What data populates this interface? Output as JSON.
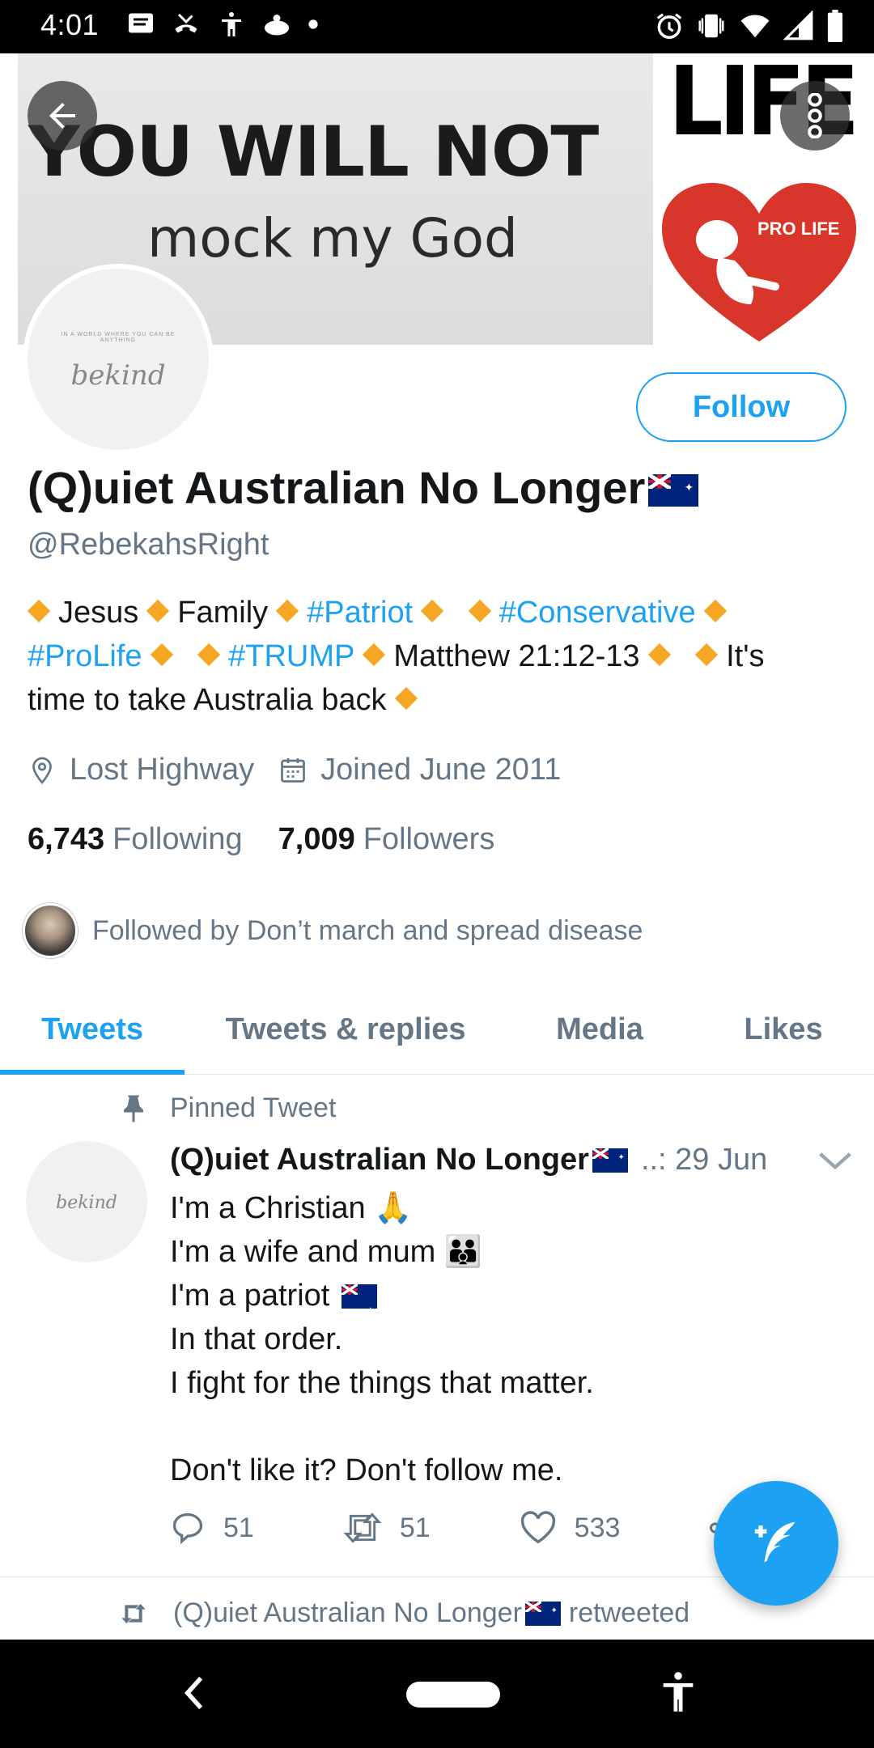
{
  "status_bar": {
    "time": "4:01",
    "notification_icons": [
      "message-icon",
      "missed-call-icon",
      "accessibility-icon",
      "cloud-icon",
      "dot-icon"
    ],
    "system_icons": [
      "alarm-icon",
      "vibrate-icon",
      "wifi-icon",
      "signal-icon",
      "battery-icon"
    ]
  },
  "banner": {
    "line1": "YOU WILL NOT",
    "line2": "mock my God",
    "right_word": "LIFE",
    "heart_text": "PRO LIFE"
  },
  "profile": {
    "avatar_text": "IN A WORLD WHERE YOU CAN BE ANYTHING",
    "avatar_script": "bekind",
    "follow_label": "Follow",
    "name": "(Q)uiet Australian No Longer",
    "handle": "@RebekahsRight",
    "bio": {
      "jesus": "Jesus",
      "family": "Family",
      "patriot": "#Patriot",
      "conservative": "#Conservative",
      "prolife": "#ProLife",
      "trump": "#TRUMP",
      "verse": "Matthew 21:12-13",
      "its": "It's",
      "closing": "time to take Australia back"
    },
    "location": "Lost Highway",
    "joined": "Joined June 2011",
    "following_count": "6,743",
    "following_label": "Following",
    "followers_count": "7,009",
    "followers_label": "Followers",
    "followed_by": "Followed by Don’t march and spread disease"
  },
  "tabs": [
    {
      "label": "Tweets",
      "active": true
    },
    {
      "label": "Tweets & replies",
      "active": false
    },
    {
      "label": "Media",
      "active": false
    },
    {
      "label": "Likes",
      "active": false
    }
  ],
  "pinned_tweet": {
    "pinned_label": "Pinned Tweet",
    "author": "(Q)uiet Australian No Longer",
    "date": "..: 29 Jun",
    "lines": [
      "I'm a Christian 🙏",
      "I'm a wife and mum 👪",
      "I'm a patriot",
      "In that order.",
      "I fight for the things that matter.",
      "",
      "Don't like it? Don't follow me."
    ],
    "replies": "51",
    "retweets": "51",
    "likes": "533"
  },
  "next_item": {
    "retweeted_name": "(Q)uiet Australian No Longer",
    "retweeted_suffix": "retweeted"
  },
  "colors": {
    "accent": "#1da1f2",
    "secondary_text": "#657786",
    "diamond": "#f5a623"
  }
}
